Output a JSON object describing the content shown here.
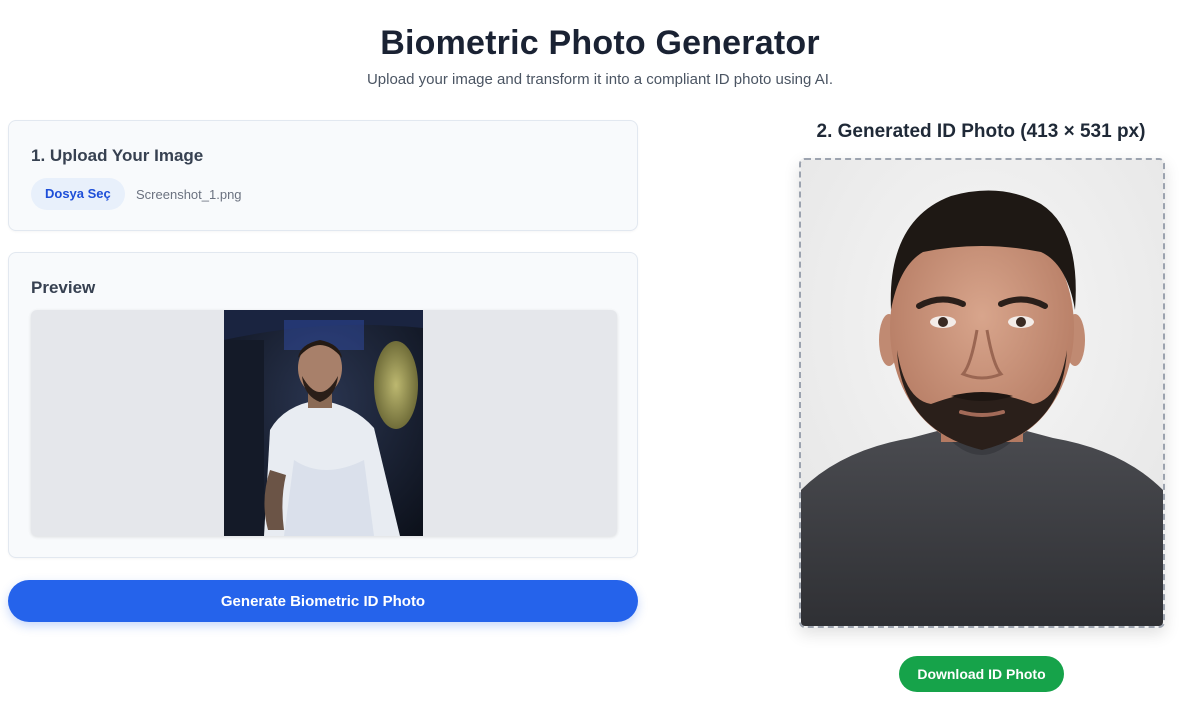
{
  "header": {
    "title": "Biometric Photo Generator",
    "subtitle": "Upload your image and transform it into a compliant ID photo using AI."
  },
  "upload": {
    "title": "1. Upload Your Image",
    "choose_file_label": "Dosya Seç",
    "file_name": "Screenshot_1.png"
  },
  "preview": {
    "title": "Preview"
  },
  "generate_button_label": "Generate Biometric ID Photo",
  "result": {
    "title": "2. Generated ID Photo (413 × 531 px)",
    "download_label": "Download ID Photo"
  },
  "colors": {
    "primary": "#2563eb",
    "success": "#16a34a",
    "card_bg": "#f8fafc"
  }
}
